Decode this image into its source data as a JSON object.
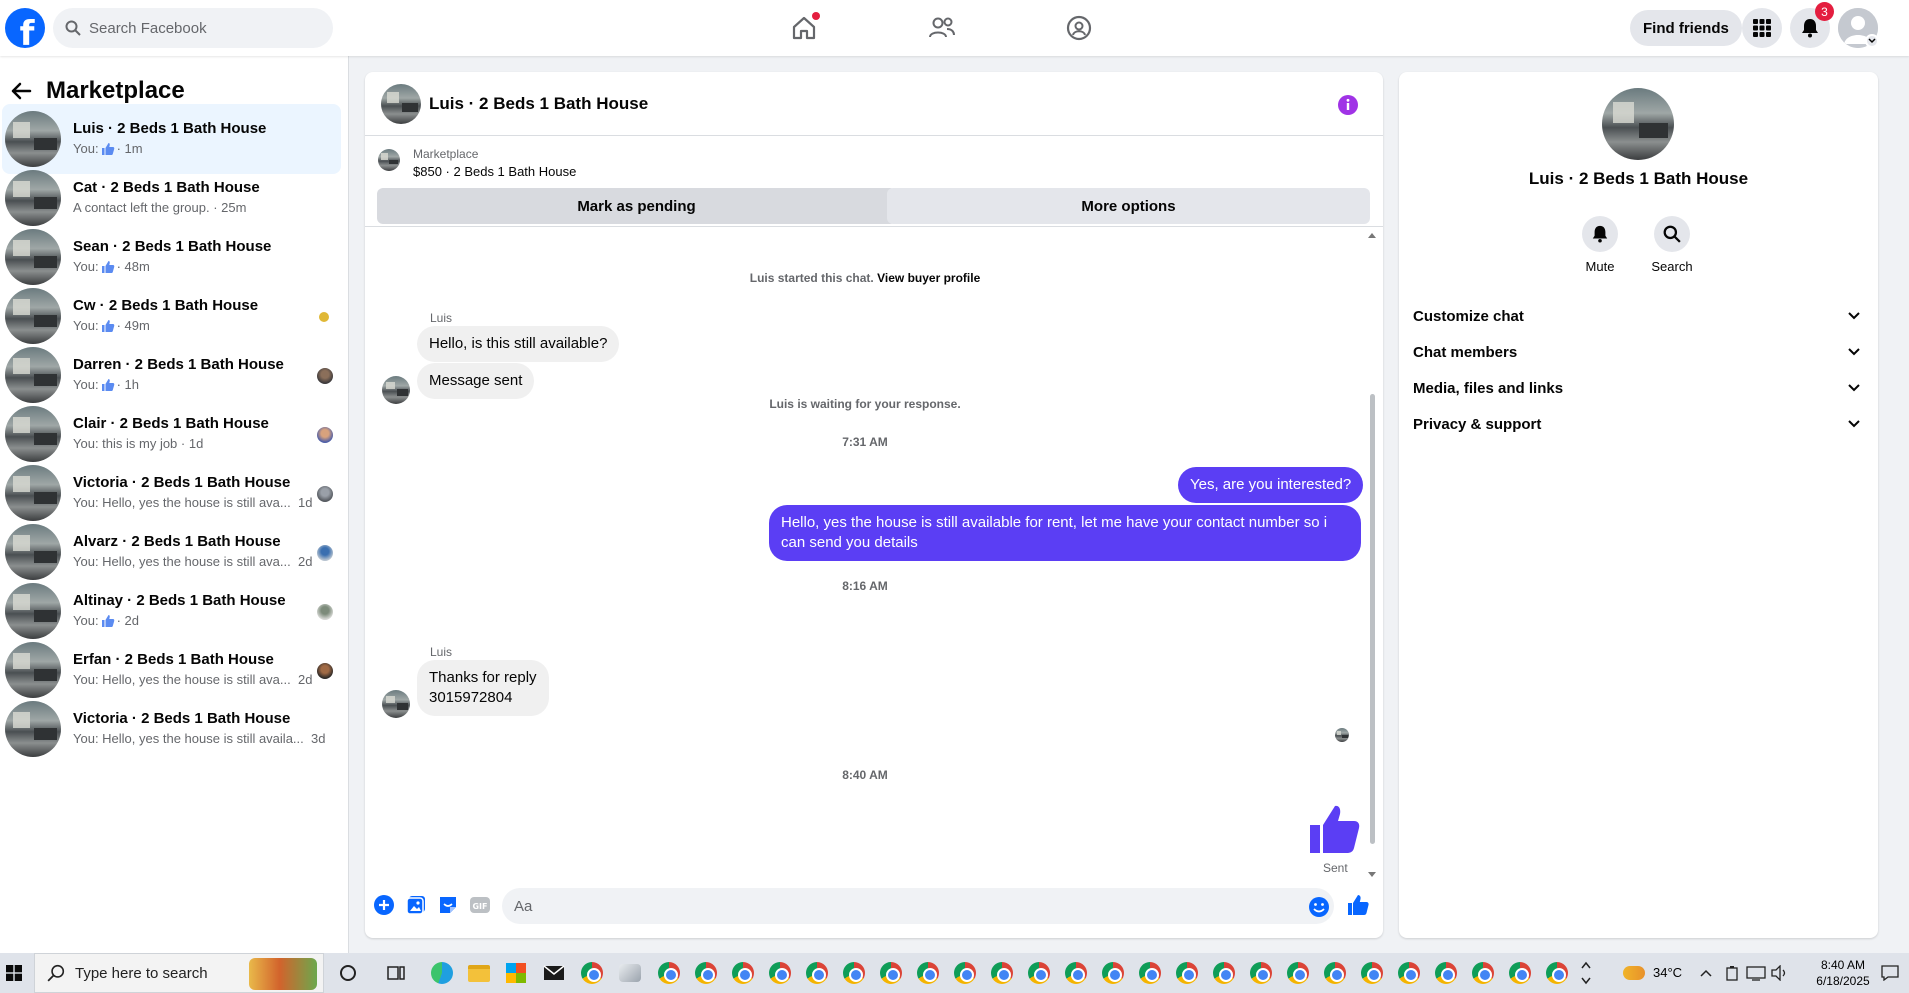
{
  "topbar": {
    "logo": "f",
    "search_placeholder": "Search Facebook",
    "find_friends": "Find friends",
    "notification_count": "3",
    "accent": "#0866ff"
  },
  "sidebar": {
    "title": "Marketplace",
    "conversations": [
      {
        "name": "Luis · 2 Beds 1 Bath House",
        "prefix": "You:",
        "liked": true,
        "preview": "",
        "time": "· 1m",
        "active": true
      },
      {
        "name": "Cat · 2 Beds 1 Bath House",
        "prefix": "",
        "liked": false,
        "preview": "A contact left the group.",
        "time": "· 25m"
      },
      {
        "name": "Sean · 2 Beds 1 Bath House",
        "prefix": "You:",
        "liked": true,
        "preview": "",
        "time": "· 48m"
      },
      {
        "name": "Cw · 2 Beds 1 Bath House",
        "prefix": "You:",
        "liked": true,
        "preview": "",
        "time": "· 49m"
      },
      {
        "name": "Darren · 2 Beds 1 Bath House",
        "prefix": "You:",
        "liked": true,
        "preview": "",
        "time": "· 1h"
      },
      {
        "name": "Clair · 2 Beds 1 Bath House",
        "prefix": "",
        "liked": false,
        "preview": "You: this is my job",
        "time": "· 1d"
      },
      {
        "name": "Victoria · 2 Beds 1 Bath House",
        "prefix": "",
        "liked": false,
        "preview": "You: Hello, yes the house is still ava...",
        "time": "1d"
      },
      {
        "name": "Alvarz · 2 Beds 1 Bath House",
        "prefix": "",
        "liked": false,
        "preview": "You: Hello, yes the house is still ava...",
        "time": "2d"
      },
      {
        "name": "Altinay · 2 Beds 1 Bath House",
        "prefix": "You:",
        "liked": true,
        "preview": "",
        "time": "· 2d"
      },
      {
        "name": "Erfan · 2 Beds 1 Bath House",
        "prefix": "",
        "liked": false,
        "preview": "You: Hello, yes the house is still ava...",
        "time": "2d"
      },
      {
        "name": "Victoria · 2 Beds 1 Bath House",
        "prefix": "",
        "liked": false,
        "preview": "You: Hello, yes the house is still availa...",
        "time": "3d"
      }
    ]
  },
  "chat": {
    "title": "Luis · 2 Beds 1 Bath House",
    "listing_source": "Marketplace",
    "listing_price": "$850 · 2 Beds 1 Bath House",
    "mark_pending": "Mark as pending",
    "more_options": "More options",
    "started_note": "Luis started this chat.",
    "view_buyer_profile": "View buyer profile",
    "sender1": "Luis",
    "msg1": "Hello, is this still available?",
    "msg2": "Message sent",
    "waiting_note": "Luis is waiting for your response.",
    "time1": "7:31 AM",
    "out1": "Yes, are you interested?",
    "out2": "Hello, yes the house is still available for rent, let me have your contact number so i can send you details",
    "time2": "8:16 AM",
    "sender2": "Luis",
    "msg3_line1": "Thanks for reply",
    "msg3_line2": "3015972804",
    "time3": "8:40 AM",
    "sent_label": "Sent",
    "composer_placeholder": "Aa",
    "outgoing_color": "#5b3ef4"
  },
  "info_panel": {
    "title": "Luis · 2 Beds 1 Bath House",
    "mute": "Mute",
    "search": "Search",
    "rows": [
      "Customize chat",
      "Chat members",
      "Media, files and links",
      "Privacy & support"
    ]
  },
  "taskbar": {
    "search_placeholder": "Type here to search",
    "weather": "34°C",
    "time": "8:40 AM",
    "date": "6/18/2025"
  }
}
